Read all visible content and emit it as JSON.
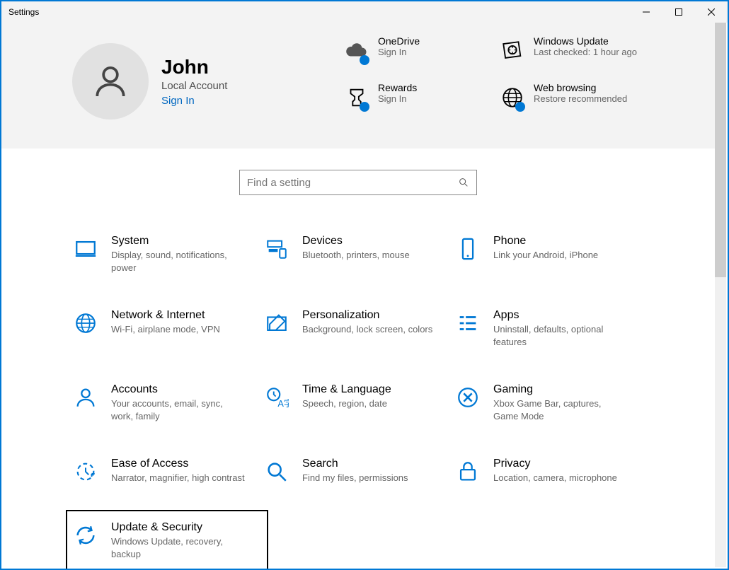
{
  "window": {
    "title": "Settings"
  },
  "user": {
    "name": "John",
    "account_type": "Local Account",
    "sign_in": "Sign In"
  },
  "status": [
    {
      "title": "OneDrive",
      "subtitle": "Sign In",
      "icon": "cloud",
      "dot": true
    },
    {
      "title": "Windows Update",
      "subtitle": "Last checked: 1 hour ago",
      "icon": "update",
      "dot": false
    },
    {
      "title": "Rewards",
      "subtitle": "Sign In",
      "icon": "rewards",
      "dot": true
    },
    {
      "title": "Web browsing",
      "subtitle": "Restore recommended",
      "icon": "globe",
      "dot": true
    }
  ],
  "search": {
    "placeholder": "Find a setting"
  },
  "categories": [
    {
      "title": "System",
      "subtitle": "Display, sound, notifications, power",
      "icon": "system"
    },
    {
      "title": "Devices",
      "subtitle": "Bluetooth, printers, mouse",
      "icon": "devices"
    },
    {
      "title": "Phone",
      "subtitle": "Link your Android, iPhone",
      "icon": "phone"
    },
    {
      "title": "Network & Internet",
      "subtitle": "Wi-Fi, airplane mode, VPN",
      "icon": "network"
    },
    {
      "title": "Personalization",
      "subtitle": "Background, lock screen, colors",
      "icon": "personalization"
    },
    {
      "title": "Apps",
      "subtitle": "Uninstall, defaults, optional features",
      "icon": "apps"
    },
    {
      "title": "Accounts",
      "subtitle": "Your accounts, email, sync, work, family",
      "icon": "accounts"
    },
    {
      "title": "Time & Language",
      "subtitle": "Speech, region, date",
      "icon": "time"
    },
    {
      "title": "Gaming",
      "subtitle": "Xbox Game Bar, captures, Game Mode",
      "icon": "gaming"
    },
    {
      "title": "Ease of Access",
      "subtitle": "Narrator, magnifier, high contrast",
      "icon": "ease"
    },
    {
      "title": "Search",
      "subtitle": "Find my files, permissions",
      "icon": "search"
    },
    {
      "title": "Privacy",
      "subtitle": "Location, camera, microphone",
      "icon": "privacy"
    },
    {
      "title": "Update & Security",
      "subtitle": "Windows Update, recovery, backup",
      "icon": "updatesec",
      "highlighted": true
    }
  ]
}
